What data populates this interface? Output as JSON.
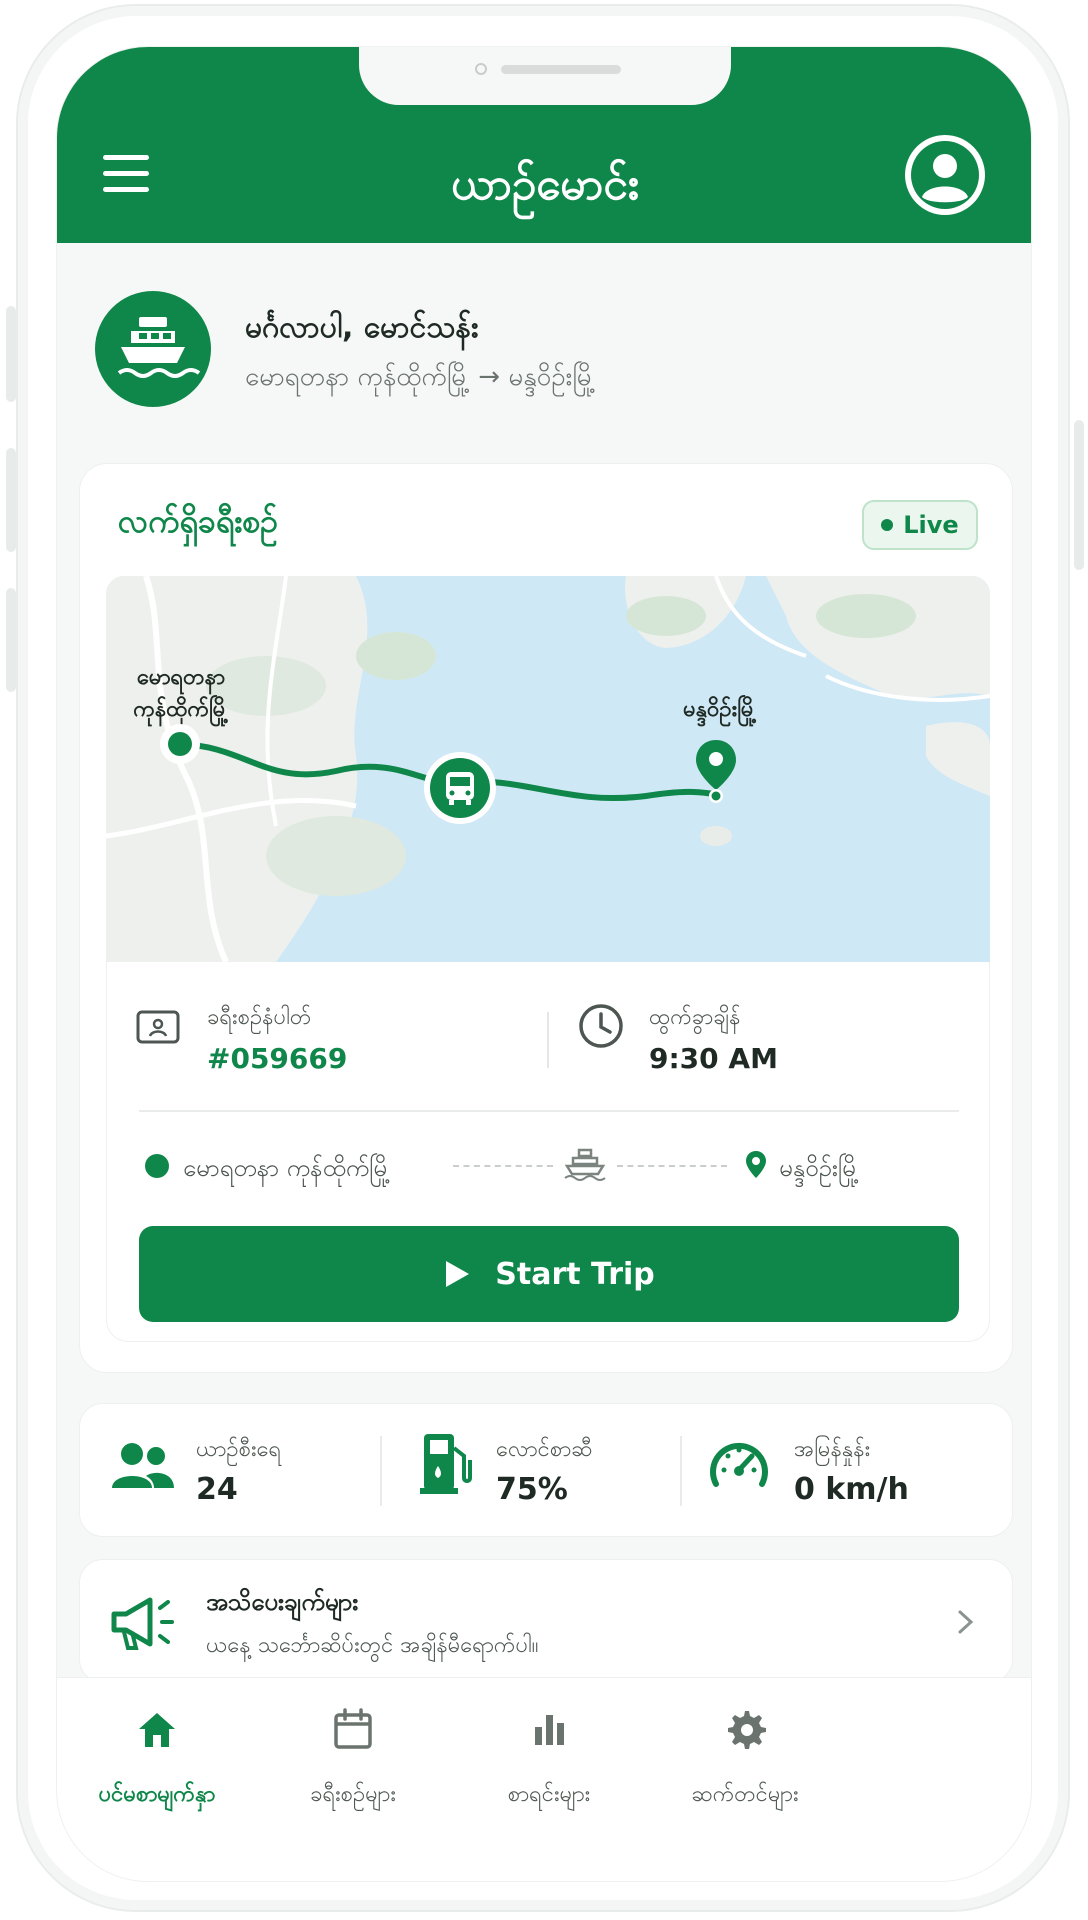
{
  "app": {
    "title": "ယာဉ်မောင်း",
    "brand_color": "#10874a"
  },
  "trip_header": {
    "greeting": "မင်္ဂလာပါ, မောင်သန်း",
    "route": "မောရတနာ ကုန်ထိုက်မြို့ → မန္ဒဝိဉ်းမြို့",
    "icon": "ferry-icon"
  },
  "current_trip": {
    "title": "လက်ရှိခရီးစဉ်",
    "live_label": "Live",
    "map": {
      "origin_label_line1": "မောရတနာ",
      "origin_label_line2": "ကုန်ထိုက်မြို့",
      "destination_label": "မန္ဒဝိဉ်းမြို့"
    },
    "trip_number_label": "ခရီးစဉ်နံပါတ်",
    "trip_number": "#059669",
    "departure_label": "ထွက်ခွာချိန်",
    "departure_time": "9:30 AM",
    "route_origin": "မောရတနာ ကုန်ထိုက်မြို့",
    "route_destination": "မန္ဒဝိဉ်းမြို့",
    "start_button": "Start Trip"
  },
  "stats": [
    {
      "label": "ယာဉ်စီးရေ",
      "value": "24",
      "icon": "passengers-icon"
    },
    {
      "label": "လောင်စာဆီ",
      "value": "75%",
      "icon": "fuel-icon"
    },
    {
      "label": "အမြန်နှုန်း",
      "value": "0 km/h",
      "icon": "speedometer-icon"
    }
  ],
  "notice": {
    "title": "အသိပေးချက်များ",
    "text": "ယနေ့ သင်္ဘောဆိပ်းတွင် အချိန်မီရောက်ပါ။"
  },
  "bottom_nav": [
    {
      "label": "ပင်မစာမျက်နှာ",
      "icon": "home-icon",
      "active": true
    },
    {
      "label": "ခရီးစဉ်များ",
      "icon": "calendar-icon",
      "active": false
    },
    {
      "label": "စာရင်းများ",
      "icon": "bar-chart-icon",
      "active": false
    },
    {
      "label": "ဆက်တင်များ",
      "icon": "gear-icon",
      "active": false
    }
  ]
}
